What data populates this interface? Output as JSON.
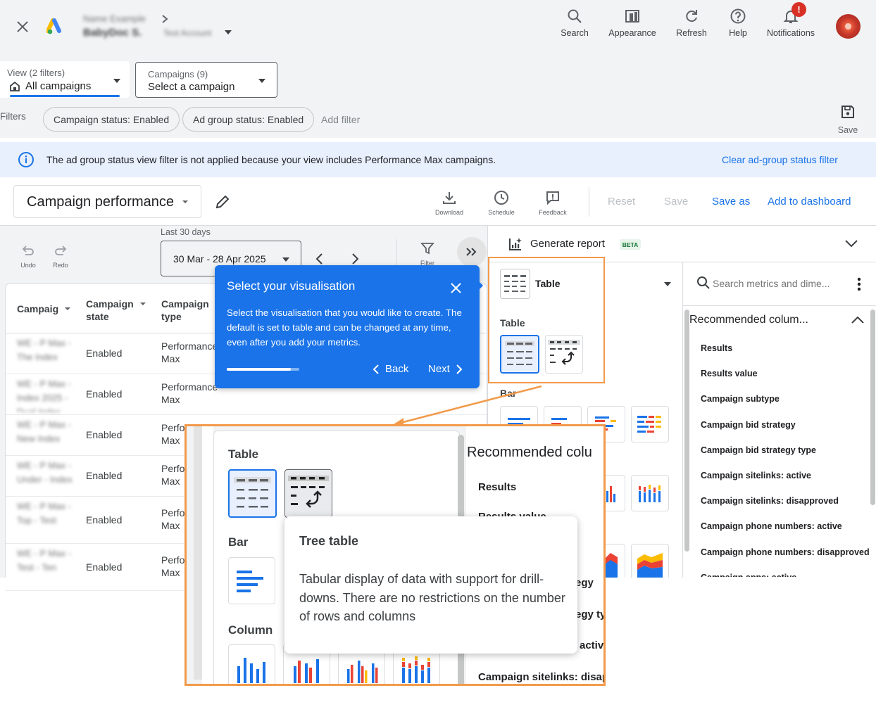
{
  "header": {
    "account_name_blur": "Name Example",
    "account_sub_blur": "BabyDoc S.",
    "account_sub2_blur": "Test Account",
    "nav": [
      {
        "label": "Search",
        "icon": "search-icon"
      },
      {
        "label": "Appearance",
        "icon": "appearance-icon"
      },
      {
        "label": "Refresh",
        "icon": "refresh-icon"
      },
      {
        "label": "Help",
        "icon": "help-icon"
      },
      {
        "label": "Notifications",
        "icon": "bell-icon"
      }
    ],
    "notification_badge": "!"
  },
  "filters_bar": {
    "view_label": "View (2 filters)",
    "view_value": "All campaigns",
    "campaigns_label": "Campaigns (9)",
    "campaigns_value": "Select a campaign",
    "filters_label": "Filters",
    "chips": [
      "Campaign status: Enabled",
      "Ad group status: Enabled"
    ],
    "add_filter": "Add filter",
    "save_label": "Save"
  },
  "info_banner": {
    "text": "The ad group status view filter is not applied because your view includes Performance Max campaigns.",
    "action": "Clear ad-group status filter"
  },
  "report_bar": {
    "title": "Campaign performance",
    "download": "Download",
    "schedule": "Schedule",
    "feedback": "Feedback",
    "reset": "Reset",
    "save": "Save",
    "save_as": "Save as",
    "add_dashboard": "Add to dashboard"
  },
  "toolbar": {
    "undo": "Undo",
    "redo": "Redo",
    "date_caption": "Last 30 days",
    "date_range": "30 Mar - 28 Apr 2025",
    "filter": "Filter"
  },
  "table": {
    "headers": [
      "Campaig",
      "Campaign state",
      "Campaign type"
    ],
    "rows": [
      {
        "name": "WE - P Max - The Index",
        "state": "Enabled",
        "type": "Performance Max"
      },
      {
        "name": "WE - P Max - Index 2025 - Dual Index",
        "state": "Enabled",
        "type": "Performance Max"
      },
      {
        "name": "WE - P Max - New Index",
        "state": "Enabled",
        "type": "Performance Max"
      },
      {
        "name": "WE - P Max - Under - Index",
        "state": "Enabled",
        "type": "Performance Max"
      },
      {
        "name": "WE - P Max - Top - Test",
        "state": "Enabled",
        "type": "Performance Max"
      },
      {
        "name": "WE - P Max - Test - Ten",
        "state": "Enabled",
        "type": "Performance Max"
      }
    ]
  },
  "coachmark": {
    "title": "Select your visualisation",
    "body": "Select the visualisation that you would like to create. The default is set to table and can be changed at any time, even after you add your metrics.",
    "back": "Back",
    "next": "Next",
    "progress": 0.88
  },
  "right_panel": {
    "generate_report": "Generate report",
    "beta": "BETA",
    "viz_selected": "Table",
    "search_placeholder": "Search metrics and dime...",
    "table_section": "Table",
    "bar_section": "Bar",
    "recommended_title": "Recommended colum...",
    "recommended_items": [
      "Results",
      "Results value",
      "Campaign subtype",
      "Campaign bid strategy",
      "Campaign bid strategy type",
      "Campaign sitelinks: active",
      "Campaign sitelinks: disapproved",
      "Campaign phone numbers: active",
      "Campaign phone numbers: disapproved",
      "Campaign apps: active"
    ]
  },
  "zoom": {
    "table_section": "Table",
    "bar_section": "Bar",
    "column_section": "Column",
    "recommended_title": "Recommended colu",
    "items": [
      "Results",
      "Results value",
      "egy",
      "egy ty",
      "activ",
      "Campaign sitelinks: disap"
    ],
    "tooltip_title": "Tree table",
    "tooltip_body": "Tabular display of data with support for drill-downs. There are no restrictions on the number of rows and columns"
  },
  "colors": {
    "accent": "#1a73e8",
    "highlight": "#f29a4a",
    "coach": "#1a73e8"
  }
}
